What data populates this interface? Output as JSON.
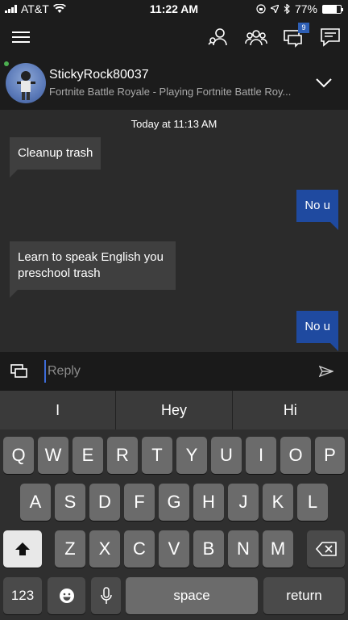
{
  "status": {
    "carrier": "AT&T",
    "time": "11:22 AM",
    "battery": "77%",
    "battery_level": 0.77
  },
  "appbar": {
    "messages_badge": "9"
  },
  "conversation": {
    "gamertag": "StickyRock80037",
    "activity": "Fortnite Battle Royale - Playing Fortnite Battle Roy..."
  },
  "chat": {
    "timestamp": "Today at 11:13 AM",
    "messages": [
      {
        "direction": "in",
        "text": "Cleanup trash"
      },
      {
        "direction": "out",
        "text": "No u"
      },
      {
        "direction": "in",
        "text": "Learn to speak English you preschool trash"
      },
      {
        "direction": "out",
        "text": "No u"
      }
    ]
  },
  "reply": {
    "placeholder": "Reply",
    "value": ""
  },
  "suggestions": [
    "I",
    "Hey",
    "Hi"
  ],
  "keyboard": {
    "row1": [
      "Q",
      "W",
      "E",
      "R",
      "T",
      "Y",
      "U",
      "I",
      "O",
      "P"
    ],
    "row2": [
      "A",
      "S",
      "D",
      "F",
      "G",
      "H",
      "J",
      "K",
      "L"
    ],
    "row3": [
      "Z",
      "X",
      "C",
      "V",
      "B",
      "N",
      "M"
    ],
    "numbers_label": "123",
    "space_label": "space",
    "return_label": "return"
  },
  "colors": {
    "accent": "#1f4aa0",
    "badge": "#2e5fb5",
    "presence": "#4caf50"
  }
}
